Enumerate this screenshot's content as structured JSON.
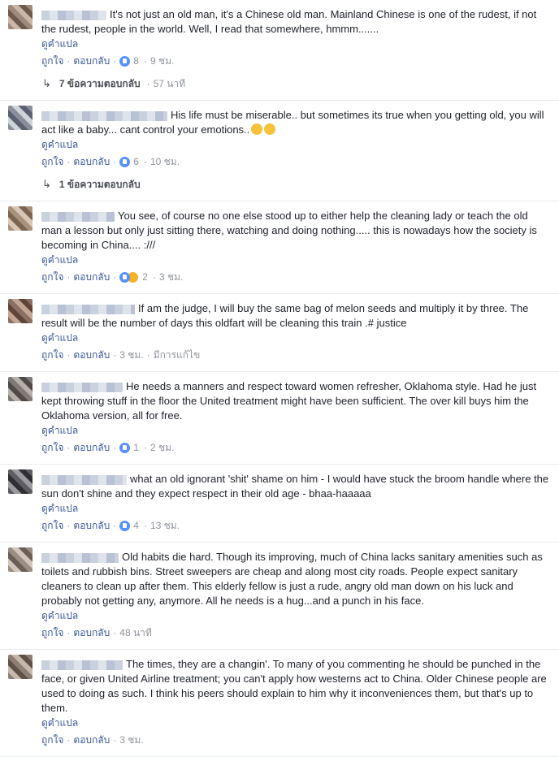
{
  "ui": {
    "translate": "ดูคำแปล",
    "like": "ถูกใจ",
    "reply": "ตอบกลับ",
    "edited": "มีการแก้ไข",
    "dot": "·"
  },
  "comments": [
    {
      "text": "It's not just an old man, it's a Chinese old man. Mainland Chinese is one of the rudest, if not the rudest, people in the world. Well, I read that somewhere, hmmm.......",
      "reactions": [
        "like"
      ],
      "count": "8",
      "time": "9 ชม.",
      "replies_text": "7 ข้อความตอบกลับ",
      "replies_time": "57 นาที"
    },
    {
      "text": "His life must be miserable.. but sometimes its true when you getting old, you will act like a baby... cant control your emotions..",
      "reactions": [
        "like"
      ],
      "count": "6",
      "time": "10 ชม.",
      "replies_text": "1 ข้อความตอบกลับ",
      "replies_time": ""
    },
    {
      "text": "You see, of course no one else stood up to either help the cleaning lady or teach the old man a lesson but only just sitting there, watching and doing nothing..... this is nowadays how the society is becoming in China.... :///",
      "reactions": [
        "like",
        "haha"
      ],
      "count": "2",
      "time": "3 ชม."
    },
    {
      "text": "If am the judge, I will buy the same bag of melon seeds and multiply it by three. The result will be the number of days this oldfart will be cleaning this train .# justice",
      "reactions": [],
      "count": "",
      "time": "3 ชม.",
      "edited": true
    },
    {
      "text": "He needs a manners and respect toward women refresher, Oklahoma style. Had he just kept throwing stuff in the floor the United treatment might have been sufficient. The over kill buys him the Oklahoma version, all for free.",
      "reactions": [
        "like"
      ],
      "count": "1",
      "time": "2 ชม."
    },
    {
      "text": "what an old ignorant 'shit' shame on him - I would have stuck the broom handle where the sun don't shine and they expect respect in their old age - bhaa-haaaaa",
      "reactions": [
        "like"
      ],
      "count": "4",
      "time": "13 ชม."
    },
    {
      "text": "Old habits die hard. Though its improving, much of China lacks sanitary amenities such as toilets and rubbish bins. Street sweepers are cheap and along most city roads. People expect sanitary cleaners to clean up after them. This elderly fellow is just a rude, angry old man down on his luck and probably not getting any, anymore. All he needs is a hug...and a punch in his face.",
      "reactions": [],
      "count": "",
      "time": "48 นาที"
    },
    {
      "text": "The times, they are a changin'. To many of you commenting he should be punched in the face, or given United Airline treatment; you can't apply how westerns act to China. Older Chinese people are used to doing as such. I think his peers should explain to him why it inconveniences them, but that's up to them.",
      "reactions": [],
      "count": "",
      "time": "3 ชม."
    }
  ]
}
